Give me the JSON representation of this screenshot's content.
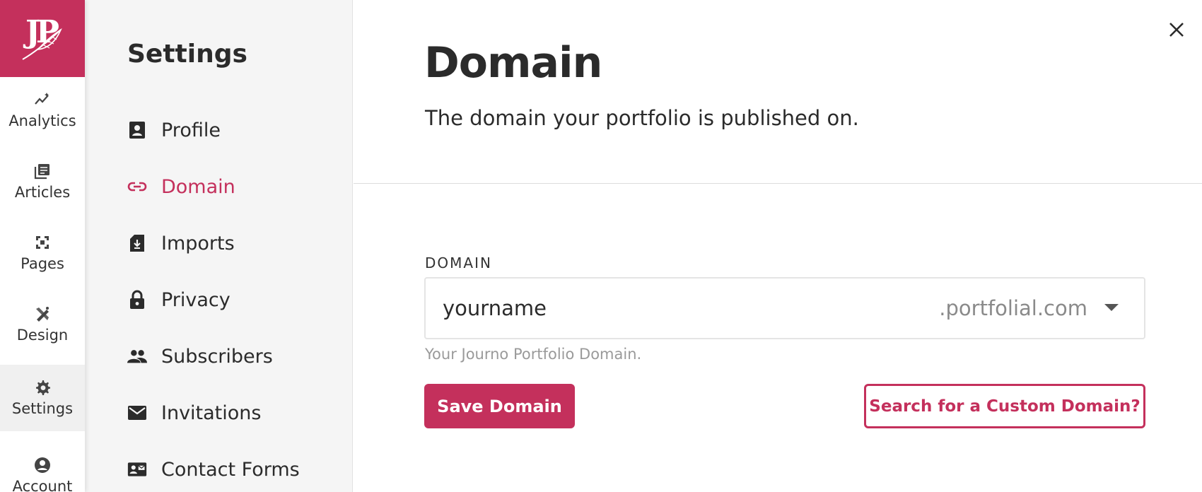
{
  "brand": {
    "logo_text": "JP",
    "accent_color": "#c4305c",
    "logo_icon": "feather-icon"
  },
  "rail": {
    "items": [
      {
        "label": "Analytics",
        "icon": "analytics-icon",
        "active": false
      },
      {
        "label": "Articles",
        "icon": "articles-icon",
        "active": false
      },
      {
        "label": "Pages",
        "icon": "pages-icon",
        "active": false
      },
      {
        "label": "Design",
        "icon": "design-icon",
        "active": false
      },
      {
        "label": "Settings",
        "icon": "gear-icon",
        "active": true
      },
      {
        "label": "Account",
        "icon": "account-icon",
        "active": false
      }
    ]
  },
  "subnav": {
    "title": "Settings",
    "items": [
      {
        "label": "Profile",
        "icon": "profile-icon",
        "active": false
      },
      {
        "label": "Domain",
        "icon": "link-icon",
        "active": true
      },
      {
        "label": "Imports",
        "icon": "import-icon",
        "active": false
      },
      {
        "label": "Privacy",
        "icon": "lock-icon",
        "active": false
      },
      {
        "label": "Subscribers",
        "icon": "people-icon",
        "active": false
      },
      {
        "label": "Invitations",
        "icon": "mail-icon",
        "active": false
      },
      {
        "label": "Contact Forms",
        "icon": "contact-card-icon",
        "active": false
      }
    ]
  },
  "main": {
    "title": "Domain",
    "subtitle": "The domain your portfolio is published on.",
    "field": {
      "label": "DOMAIN",
      "value": "yourname",
      "suffix": ".portfolial.com",
      "helper": "Your Journo Portfolio Domain."
    },
    "save_label": "Save Domain",
    "custom_label": "Search for a Custom Domain?"
  }
}
